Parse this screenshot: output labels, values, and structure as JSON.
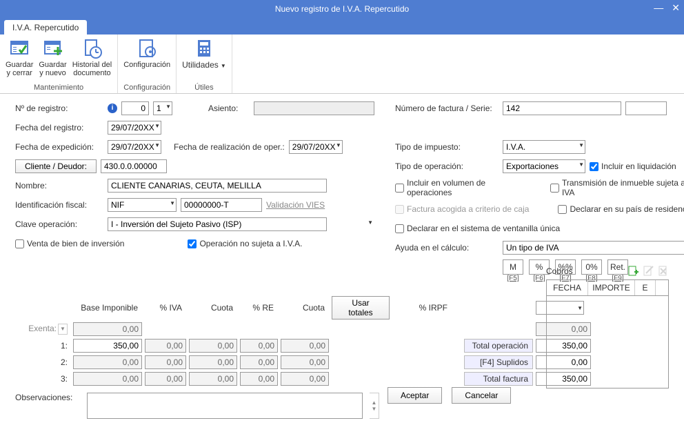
{
  "window": {
    "title": "Nuevo registro de I.V.A. Repercutido"
  },
  "tab": {
    "label": "I.V.A. Repercutido"
  },
  "ribbon": {
    "group1": {
      "label": "Mantenimiento",
      "save_close": "Guardar\ny cerrar",
      "save_new": "Guardar\ny nuevo",
      "history": "Historial del\ndocumento"
    },
    "group2": {
      "label": "Configuración",
      "config": "Configuración"
    },
    "group3": {
      "label": "Útiles",
      "utils": "Utilidades"
    }
  },
  "form": {
    "nregistro_label": "Nº de registro:",
    "nregistro_val": "0",
    "nregistro_sub": "1",
    "asiento_label": "Asiento:",
    "asiento_val": "",
    "fecha_reg_label": "Fecha del registro:",
    "fecha_reg_val": "29/07/20XX",
    "fecha_exp_label": "Fecha de expedición:",
    "fecha_exp_val": "29/07/20XX",
    "fecha_oper_label": "Fecha de realización de oper.:",
    "fecha_oper_val": "29/07/20XX",
    "cliente_btn": "Cliente / Deudor:",
    "cliente_val": "430.0.0.00000",
    "nombre_label": "Nombre:",
    "nombre_val": "CLIENTE CANARIAS, CEUTA, MELILLA",
    "idfiscal_label": "Identificación fiscal:",
    "idfiscal_type": "NIF",
    "idfiscal_val": "00000000-T",
    "vies_link": "Validación VIES",
    "clave_label": "Clave operación:",
    "clave_val": "I - Inversión del Sujeto Pasivo (ISP)",
    "chk_venta_inv": "Venta de bien de inversión",
    "chk_no_sujeta": "Operación no sujeta a I.V.A.",
    "factura_label": "Número de factura / Serie:",
    "factura_val": "142",
    "serie_val": "",
    "tipo_imp_label": "Tipo de impuesto:",
    "tipo_imp_val": "I.V.A.",
    "tipo_oper_label": "Tipo de operación:",
    "tipo_oper_val": "Exportaciones",
    "chk_incluir_liq": "Incluir en liquidación",
    "chk_incluir_vol": "Incluir en volumen de operaciones",
    "chk_transmision": "Transmisión de inmueble sujeta a IVA",
    "chk_criterio_caja": "Factura acogida a criterio de caja",
    "chk_pais_res": "Declarar en su país de residencia",
    "chk_ventanilla": "Declarar en el sistema de ventanilla única",
    "ayuda_label": "Ayuda en el cálculo:",
    "ayuda_val": "Un tipo de IVA",
    "help_m": "M",
    "help_pct": "%",
    "help_pctpct": "%%",
    "help_0pct": "0%",
    "help_ret": "Ret.",
    "help_f5": "[F5]",
    "help_f6": "[F6]",
    "help_f7": "[F7]",
    "help_f8": "[F8]",
    "help_f9": "[F9]"
  },
  "grid": {
    "hdr_base": "Base Imponible",
    "hdr_pctiva": "% IVA",
    "hdr_cuota": "Cuota",
    "hdr_pctre": "% RE",
    "hdr_cuota2": "Cuota",
    "btn_usar": "Usar totales",
    "hdr_pctirpf": "% IRPF",
    "exenta_label": "Exenta:",
    "exenta_val": "0,00",
    "rows": [
      {
        "lbl": "1:",
        "base": "350,00",
        "pctiva": "0,00",
        "cuota": "0,00",
        "pctre": "0,00",
        "cuota2": "0,00"
      },
      {
        "lbl": "2:",
        "base": "0,00",
        "pctiva": "0,00",
        "cuota": "0,00",
        "pctre": "0,00",
        "cuota2": "0,00"
      },
      {
        "lbl": "3:",
        "base": "0,00",
        "pctiva": "0,00",
        "cuota": "0,00",
        "pctre": "0,00",
        "cuota2": "0,00"
      }
    ],
    "irpf_cuota": "0,00",
    "total_op_label": "Total operación",
    "total_op_val": "350,00",
    "suplidos_label": "[F4] Suplidos",
    "suplidos_val": "0,00",
    "total_fac_label": "Total factura",
    "total_fac_val": "350,00",
    "deduc_val": "0,00"
  },
  "cobros": {
    "title": "Cobros",
    "col_fecha": "FECHA",
    "col_importe": "IMPORTE",
    "col_e": "E"
  },
  "obs_label": "Observaciones:",
  "obs_val": "",
  "btn_aceptar": "Aceptar",
  "btn_cancelar": "Cancelar"
}
